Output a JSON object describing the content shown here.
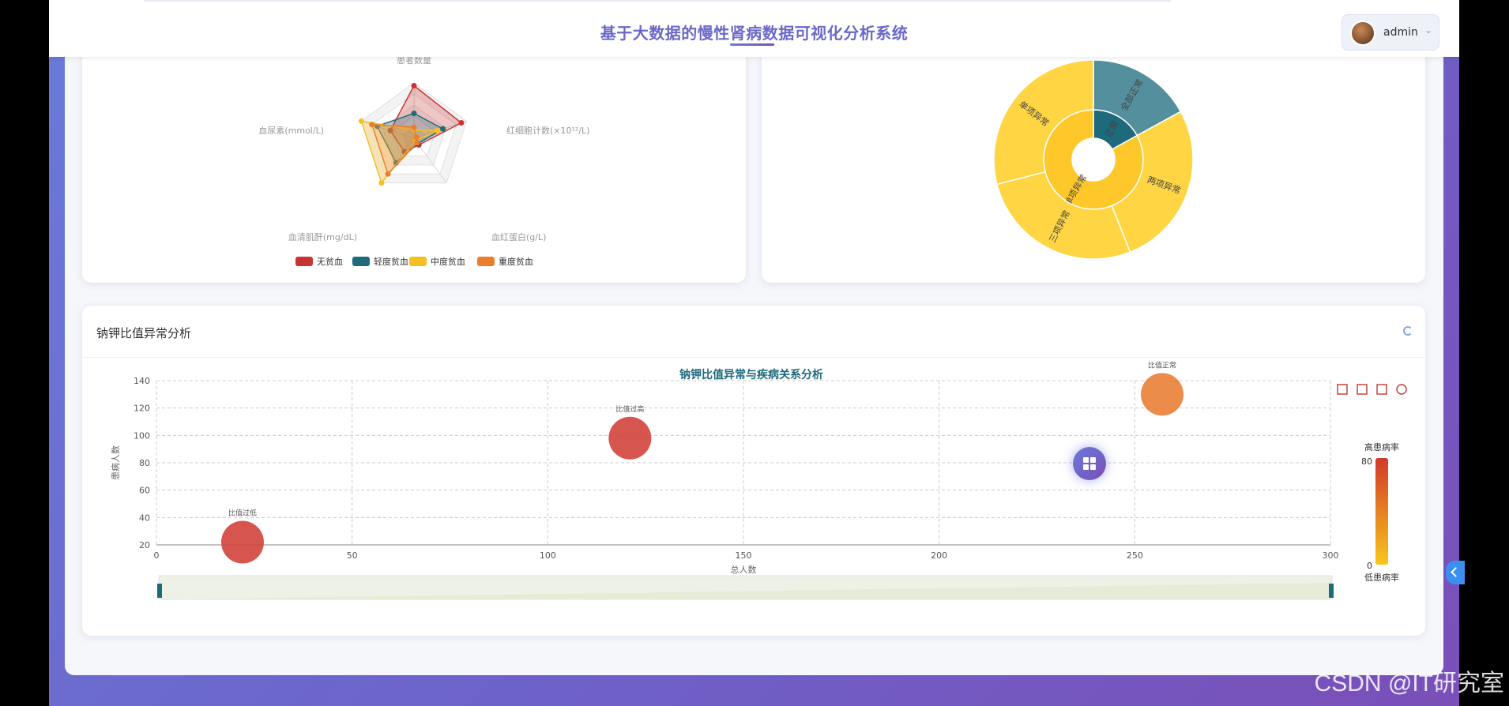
{
  "app": {
    "title": "基于大数据的慢性肾病数据可视化分析系统"
  },
  "user": {
    "name": "admin",
    "avatar_icon": "user-avatar",
    "menu_icon": "chevron-down-icon"
  },
  "radar": {
    "indicators": [
      "患者数量",
      "红细胞计数(×10¹²/L)",
      "血红蛋白(g/L)",
      "血清肌酐(mg/dL)",
      "血尿素(mmol/L)"
    ],
    "series": [
      {
        "name": "无贫血",
        "color": "#c73433",
        "values": [
          0.95,
          0.9,
          0.15,
          0.3,
          0.45
        ]
      },
      {
        "name": "轻度贫血",
        "color": "#1f6b7c",
        "values": [
          0.45,
          0.55,
          0.12,
          0.55,
          0.7
        ]
      },
      {
        "name": "中度贫血",
        "color": "#f6c022",
        "values": [
          0.15,
          0.45,
          0.05,
          1.0,
          1.0
        ]
      },
      {
        "name": "重度贫血",
        "color": "#ea7e2c",
        "values": [
          0.2,
          0.05,
          0.1,
          0.8,
          0.8
        ]
      }
    ]
  },
  "sunburst": {
    "inner": [
      {
        "name": "正常",
        "color": "#1e6a7c",
        "value": 17
      },
      {
        "name": "单项异常",
        "color": "#ffc82a",
        "value": 83
      }
    ],
    "outer": [
      {
        "name": "全部正常",
        "color": "#538f9c",
        "value": 17
      },
      {
        "name": "两项异常",
        "color": "#ffd544",
        "value": 27
      },
      {
        "name": "三项异常",
        "color": "#ffd544",
        "value": 27
      },
      {
        "name": "单项异常",
        "color": "#ffd544",
        "value": 29
      }
    ]
  },
  "bubble_panel": {
    "title": "钠钾比值异常分析",
    "refresh_icon": "refresh-icon"
  },
  "chart_data": {
    "type": "scatter",
    "title": "钠钾比值异常与疾病关系分析",
    "xlabel": "总人数",
    "ylabel": "患病人数",
    "xlim": [
      0,
      300
    ],
    "ylim": [
      20,
      140
    ],
    "xticks": [
      0,
      50,
      100,
      150,
      200,
      250,
      300
    ],
    "yticks": [
      20,
      40,
      60,
      80,
      100,
      120,
      140
    ],
    "points": [
      {
        "label": "比值过低",
        "x": 22,
        "y": 22,
        "rate": 80,
        "color": "#d3463f"
      },
      {
        "label": "比值过高",
        "x": 121,
        "y": 98,
        "rate": 80,
        "color": "#d3463f"
      },
      {
        "label": "比值正常",
        "x": 257,
        "y": 130,
        "rate": 50,
        "color": "#e9823c"
      }
    ],
    "visual_map": {
      "max_label": "高患病率",
      "min_label": "低患病率",
      "max": "80",
      "min": "0"
    },
    "toolbox": [
      "download-icon",
      "zoom-icon",
      "zoom-reset-icon",
      "restore-icon"
    ]
  },
  "watermark": "CSDN @IT研究室"
}
